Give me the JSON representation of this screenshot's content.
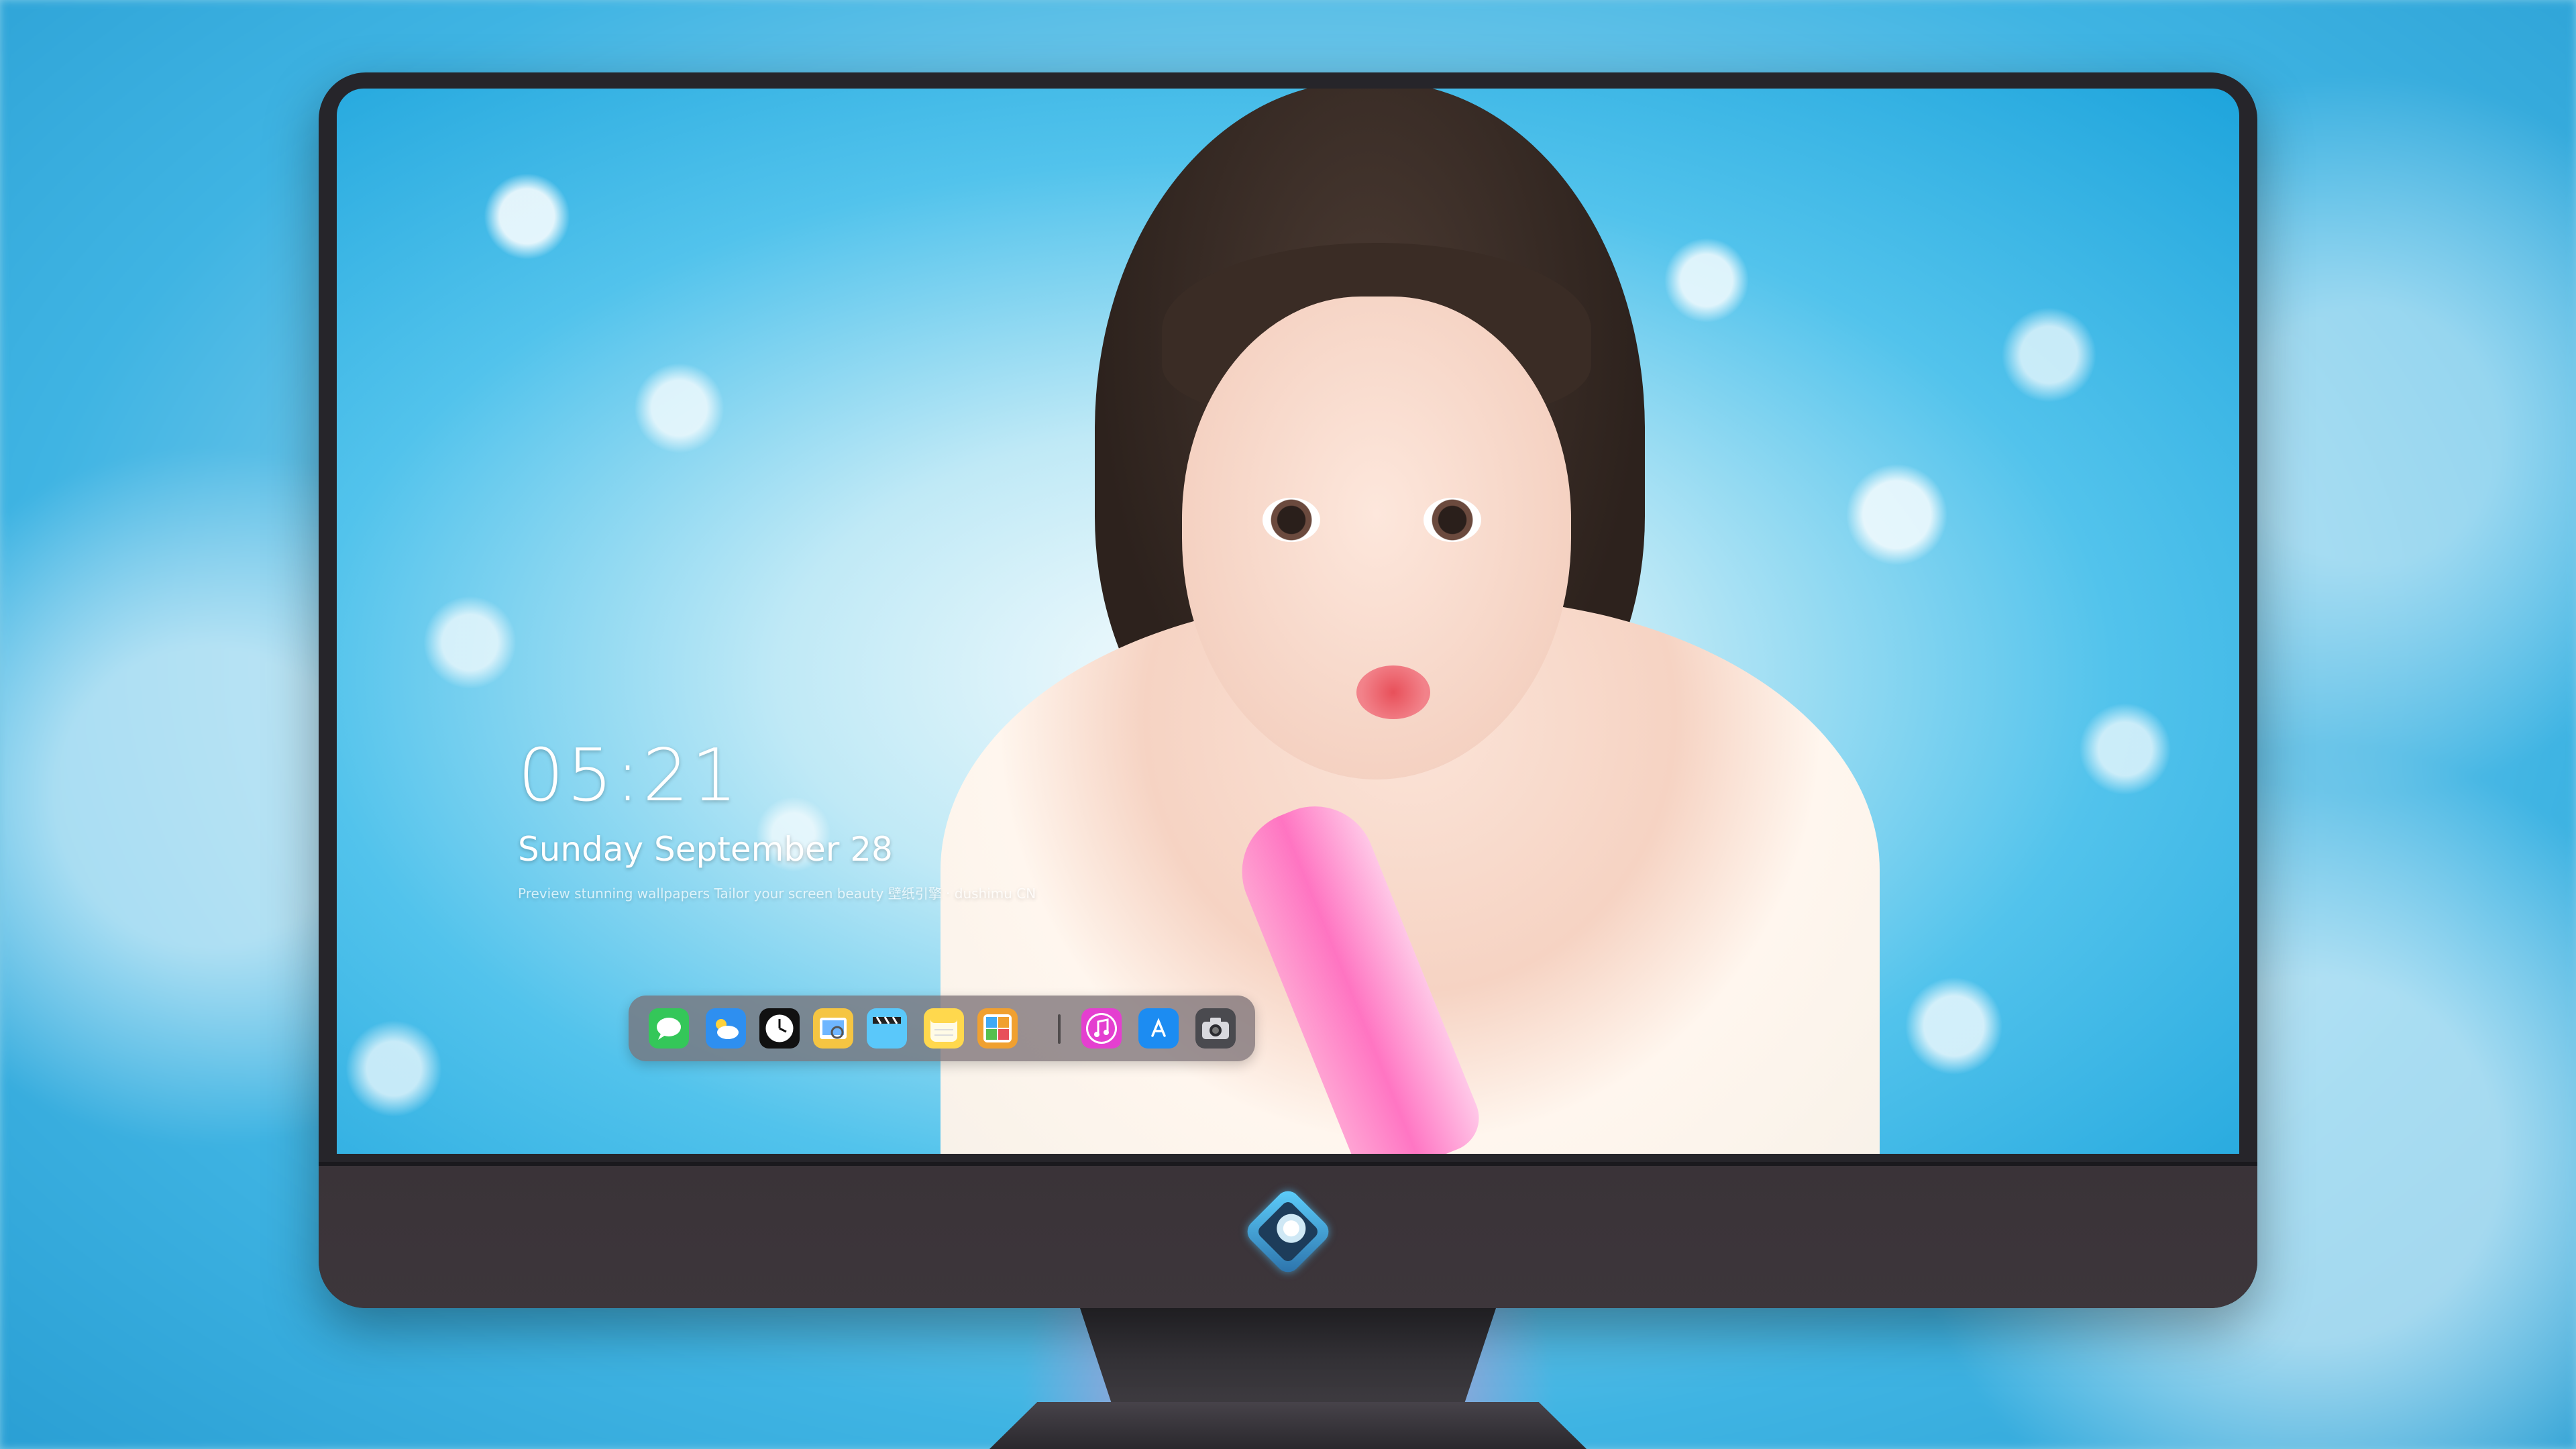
{
  "lock_screen": {
    "time": "05:21",
    "date": "Sunday September  28",
    "caption": "Preview stunning wallpapers  Tailor your screen beauty  壁纸引擎 · dushimu CN"
  },
  "dock": {
    "apps": [
      {
        "name": "Messages",
        "icon": "message-bubble-icon",
        "color": "#34c759"
      },
      {
        "name": "Weather",
        "icon": "cloud-sun-icon",
        "color": "#2e8ff0"
      },
      {
        "name": "Clock",
        "icon": "clock-icon",
        "color": "#111111"
      },
      {
        "name": "Preview",
        "icon": "preview-icon",
        "color": "#f5c542"
      },
      {
        "name": "Final Cut",
        "icon": "clapperboard-icon",
        "color": "#5ac8fa"
      },
      {
        "name": "Notes",
        "icon": "notes-icon",
        "color": "#ffd84d"
      },
      {
        "name": "Photo Library",
        "icon": "photo-grid-icon",
        "color": "#f0a030"
      },
      {
        "name": "iTunes",
        "icon": "music-note-icon",
        "color": "#e43fd0"
      },
      {
        "name": "App Store",
        "icon": "app-store-icon",
        "color": "#1c8cf2"
      },
      {
        "name": "Camera",
        "icon": "camera-icon",
        "color": "#4a4a4f"
      }
    ]
  }
}
